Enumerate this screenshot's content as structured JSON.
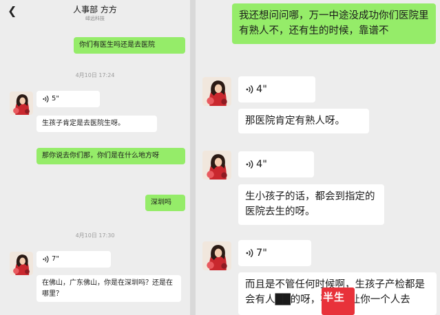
{
  "left": {
    "header": {
      "back_icon": "chevron-left-icon",
      "title": "人事部 方方",
      "subtitle": "峄远科技"
    },
    "messages": {
      "m1": "你们有医生吗还是去医院",
      "t1": "4月10日 17:24",
      "m2": "5\"",
      "m3": "生孩子肯定是去医院生呀。",
      "m4": "那你说去你们那，你们是在什么地方呀",
      "m5": "深圳吗",
      "t2": "4月10日 17:30",
      "m6": "7\"",
      "m7": "在佛山，广东佛山，你是在深圳吗？还是在哪里？"
    }
  },
  "right": {
    "messages": {
      "m1": "我还想问问哪，万一中途没成功你们医院里有熟人不，还有生的时候，靠谱不",
      "m2": "4\"",
      "m3": "那医院肯定有熟人呀。",
      "m4": "4\"",
      "m5": "生小孩子的话，都会到指定的医院去生的呀。",
      "m6": "7\"",
      "m7": "而且是不管任何时候啊，生孩子产检都是会有人██的呀，不会说让你一个人去"
    },
    "watermark": "半生"
  },
  "colors": {
    "background": "#ededed",
    "sent_bubble": "#95ec69",
    "received_bubble": "#ffffff",
    "divider": "#d9d9d9"
  }
}
